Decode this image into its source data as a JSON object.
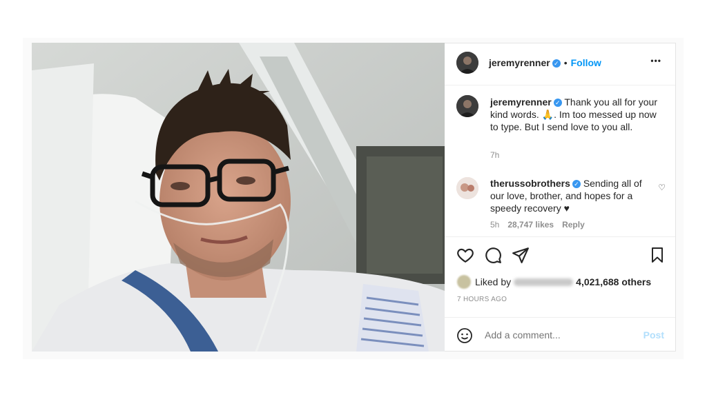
{
  "post": {
    "author": "jeremyrenner",
    "follow_label": "Follow",
    "separator": "•",
    "more_label": "•••"
  },
  "caption": {
    "username": "jeremyrenner",
    "text": "Thank you all for your kind words. 🙏. Im too messed up now to type. But I send love to you all.",
    "age": "7h"
  },
  "comment": {
    "username": "therussobrothers",
    "text": "Sending all of our love, brother, and hopes for a speedy recovery ♥",
    "age": "5h",
    "likes": "28,747 likes",
    "reply_label": "Reply"
  },
  "likes": {
    "prefix": "Liked by",
    "others": "4,021,688 others"
  },
  "timestamp": "7 HOURS AGO",
  "comment_box": {
    "placeholder": "Add a comment...",
    "post_label": "Post"
  },
  "colors": {
    "link_blue": "#0095f6",
    "verified_blue": "#3897f0",
    "post_disabled": "#b2dffc",
    "muted_text": "#8e8e8e"
  },
  "icons": [
    "verified-badge-icon",
    "more-options-icon",
    "heart-icon",
    "comment-icon",
    "share-icon",
    "bookmark-icon",
    "emoji-icon"
  ]
}
